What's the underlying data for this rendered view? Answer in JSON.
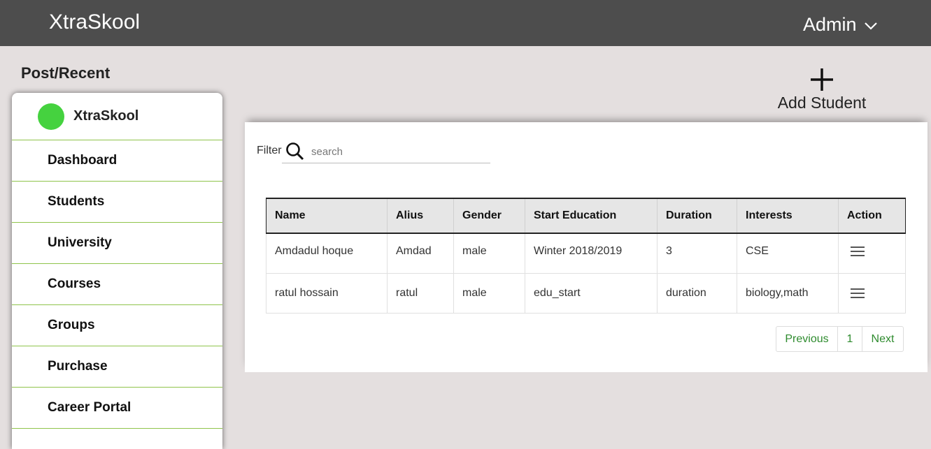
{
  "app": {
    "title": "XtraSkool"
  },
  "header": {
    "user": "Admin"
  },
  "section_title": "Post/Recent",
  "sidebar": {
    "brand": "XtraSkool",
    "items": [
      {
        "label": "Dashboard"
      },
      {
        "label": "Students"
      },
      {
        "label": "University"
      },
      {
        "label": "Courses"
      },
      {
        "label": "Groups"
      },
      {
        "label": "Purchase"
      },
      {
        "label": "Career Portal"
      }
    ]
  },
  "add_student": {
    "label": "Add Student"
  },
  "filter": {
    "label": "Filter",
    "placeholder": "search"
  },
  "table": {
    "headers": [
      "Name",
      "Alius",
      "Gender",
      "Start Education",
      "Duration",
      "Interests",
      "Action"
    ],
    "rows": [
      [
        "Amdadul hoque",
        "Amdad",
        "male",
        "Winter 2018/2019",
        "3",
        "CSE"
      ],
      [
        "ratul hossain",
        "ratul",
        "male",
        "edu_start",
        "duration",
        "biology,math"
      ]
    ]
  },
  "pagination": {
    "previous": "Previous",
    "current": "1",
    "next": "Next"
  },
  "colors": {
    "topbar": "#4d4d4d",
    "background": "#e4dfdf",
    "divider": "#8fc44b",
    "status_dot": "#45d23f",
    "pager_text": "#2e8b2e"
  },
  "icons": {
    "user_menu": "chevron-down-icon",
    "add": "plus-icon",
    "search": "search-icon",
    "action": "menu-icon"
  }
}
